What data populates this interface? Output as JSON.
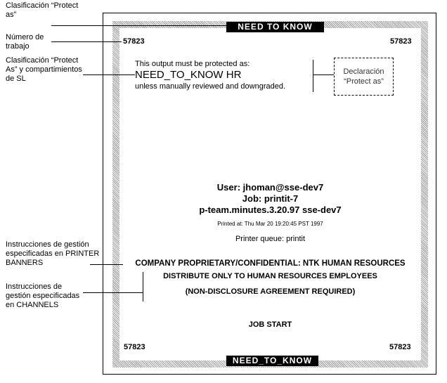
{
  "callouts": {
    "protect_as_class": "Clasificación “Protect as”",
    "job_number": "Número de trabajo",
    "protect_as_sl": "Clasificación “Protect As” y compartimientos de SL",
    "printer_banners": "Instrucciones de gestión especificadas en PRINTER BANNERS",
    "channels": "Instrucciones de gestión especificadas en CHANNELS",
    "declaration": "Declaración “Protect as”"
  },
  "page": {
    "top_banner": "NEED TO KNOW",
    "bottom_banner": "NEED_TO_KNOW",
    "job_id": "57823",
    "protect_line1": "This output must be protected as:",
    "protect_label": "NEED_TO_KNOW HR",
    "protect_line3": "unless manually reviewed and downgraded.",
    "user": "User: jhoman@sse-dev7",
    "job": "Job: printit-7",
    "file": "p-team.minutes.3.20.97 sse-dev7",
    "printed_at": "Printed at: Thu  Mar 20 19:20:45  PST 1997",
    "queue": "Printer queue: printit",
    "banner_text": "COMPANY PROPRIETARY/CONFIDENTIAL: NTK HUMAN RESOURCES",
    "channel_1": "DISTRIBUTE ONLY TO HUMAN RESOURCES EMPLOYEES",
    "channel_2": "(NON-DISCLOSURE AGREEMENT REQUIRED)",
    "job_start": "JOB START"
  }
}
